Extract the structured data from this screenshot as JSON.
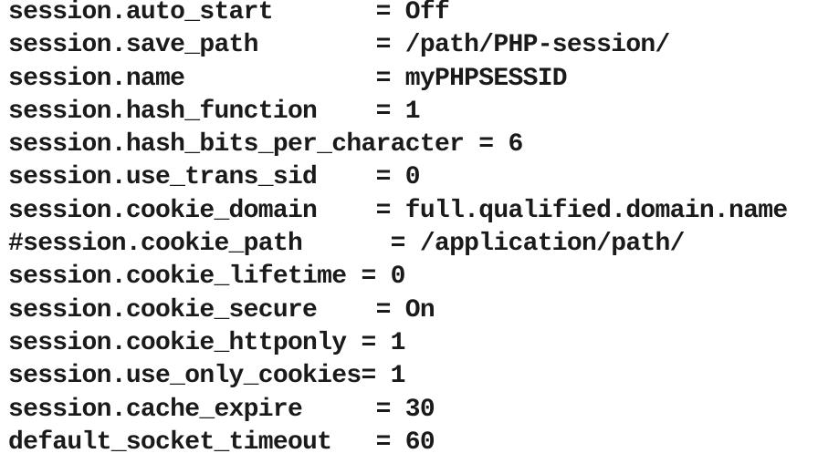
{
  "config_lines": [
    "session.auto_start       = Off",
    "session.save_path        = /path/PHP-session/",
    "session.name             = myPHPSESSID",
    "session.hash_function    = 1",
    "session.hash_bits_per_character = 6",
    "session.use_trans_sid    = 0",
    "session.cookie_domain    = full.qualified.domain.name",
    "#session.cookie_path      = /application/path/",
    "session.cookie_lifetime = 0",
    "session.cookie_secure    = On",
    "session.cookie_httponly = 1",
    "session.use_only_cookies= 1",
    "session.cache_expire     = 30",
    "default_socket_timeout   = 60"
  ]
}
